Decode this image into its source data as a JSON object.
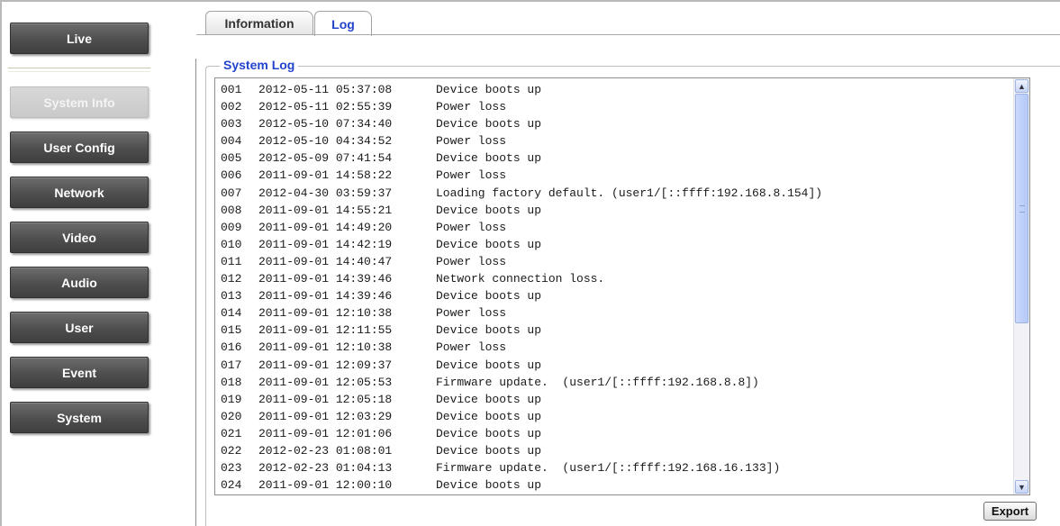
{
  "sidebar": {
    "live_label": "Live",
    "items": [
      {
        "label": "System Info",
        "active": true
      },
      {
        "label": "User Config"
      },
      {
        "label": "Network"
      },
      {
        "label": "Video"
      },
      {
        "label": "Audio"
      },
      {
        "label": "User"
      },
      {
        "label": "Event"
      },
      {
        "label": "System"
      }
    ]
  },
  "tabs": [
    {
      "label": "Information"
    },
    {
      "label": "Log",
      "active": true
    }
  ],
  "system_log": {
    "title": "System Log",
    "entries": [
      {
        "num": "001",
        "time": "2012-05-11 05:37:08",
        "msg": "Device boots up"
      },
      {
        "num": "002",
        "time": "2012-05-11 02:55:39",
        "msg": "Power loss"
      },
      {
        "num": "003",
        "time": "2012-05-10 07:34:40",
        "msg": "Device boots up"
      },
      {
        "num": "004",
        "time": "2012-05-10 04:34:52",
        "msg": "Power loss"
      },
      {
        "num": "005",
        "time": "2012-05-09 07:41:54",
        "msg": "Device boots up"
      },
      {
        "num": "006",
        "time": "2011-09-01 14:58:22",
        "msg": "Power loss"
      },
      {
        "num": "007",
        "time": "2012-04-30 03:59:37",
        "msg": "Loading factory default. (user1/[::ffff:192.168.8.154])"
      },
      {
        "num": "008",
        "time": "2011-09-01 14:55:21",
        "msg": "Device boots up"
      },
      {
        "num": "009",
        "time": "2011-09-01 14:49:20",
        "msg": "Power loss"
      },
      {
        "num": "010",
        "time": "2011-09-01 14:42:19",
        "msg": "Device boots up"
      },
      {
        "num": "011",
        "time": "2011-09-01 14:40:47",
        "msg": "Power loss"
      },
      {
        "num": "012",
        "time": "2011-09-01 14:39:46",
        "msg": "Network connection loss."
      },
      {
        "num": "013",
        "time": "2011-09-01 14:39:46",
        "msg": "Device boots up"
      },
      {
        "num": "014",
        "time": "2011-09-01 12:10:38",
        "msg": "Power loss"
      },
      {
        "num": "015",
        "time": "2011-09-01 12:11:55",
        "msg": "Device boots up"
      },
      {
        "num": "016",
        "time": "2011-09-01 12:10:38",
        "msg": "Power loss"
      },
      {
        "num": "017",
        "time": "2011-09-01 12:09:37",
        "msg": "Device boots up"
      },
      {
        "num": "018",
        "time": "2011-09-01 12:05:53",
        "msg": "Firmware update.  (user1/[::ffff:192.168.8.8])"
      },
      {
        "num": "019",
        "time": "2011-09-01 12:05:18",
        "msg": "Device boots up"
      },
      {
        "num": "020",
        "time": "2011-09-01 12:03:29",
        "msg": "Device boots up"
      },
      {
        "num": "021",
        "time": "2011-09-01 12:01:06",
        "msg": "Device boots up"
      },
      {
        "num": "022",
        "time": "2012-02-23 01:08:01",
        "msg": "Device boots up"
      },
      {
        "num": "023",
        "time": "2012-02-23 01:04:13",
        "msg": "Firmware update.  (user1/[::ffff:192.168.16.133])"
      },
      {
        "num": "024",
        "time": "2011-09-01 12:00:10",
        "msg": "Device boots up"
      }
    ],
    "export_label": "Export"
  },
  "scrollbar": {
    "up_icon": "▲",
    "down_icon": "▼"
  }
}
